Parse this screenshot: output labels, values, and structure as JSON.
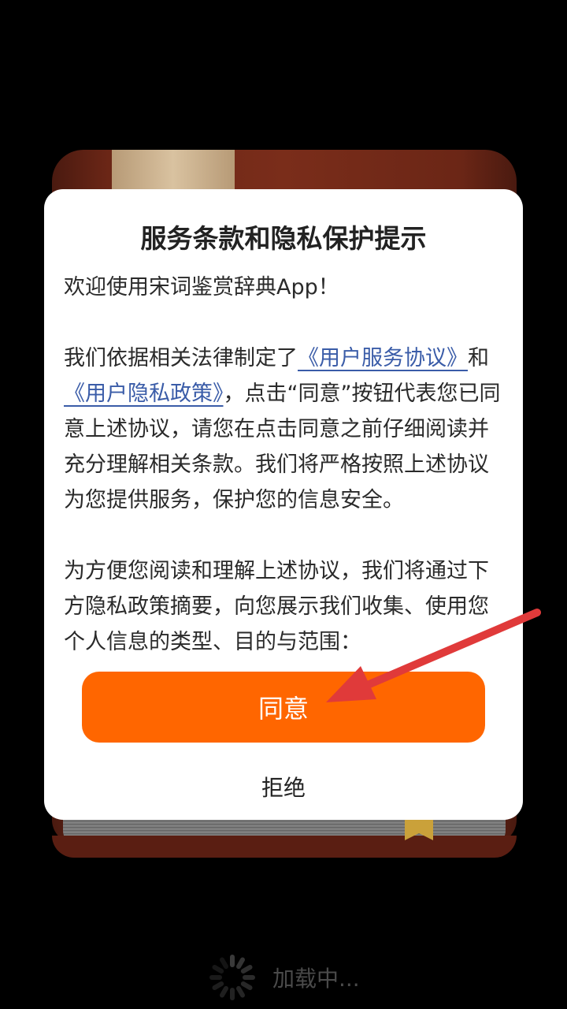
{
  "dialog": {
    "title": "服务条款和隐私保护提示",
    "welcome": "欢迎使用宋词鉴赏辞典App！",
    "para1_before": "我们依据相关法律制定了",
    "link_service": "《用户服务协议》",
    "para1_and": "和",
    "link_privacy": "《用户隐私政策》",
    "para1_after": "，点击“同意”按钮代表您已同意上述协议，请您在点击同意之前仔细阅读并充分理解相关条款。我们将严格按照上述协议为您提供服务，保护您的信息安全。",
    "para2": "为方便您阅读和理解上述协议，我们将通过下方隐私政策摘要，向您展示我们收集、使用您个人信息的类型、目的与范围：",
    "agree_label": "同意",
    "reject_label": "拒绝"
  },
  "loading": {
    "text": "加载中..."
  },
  "colors": {
    "accent": "#ff6600",
    "link": "#3a5ca8",
    "annotation_arrow": "#e03a3a"
  }
}
